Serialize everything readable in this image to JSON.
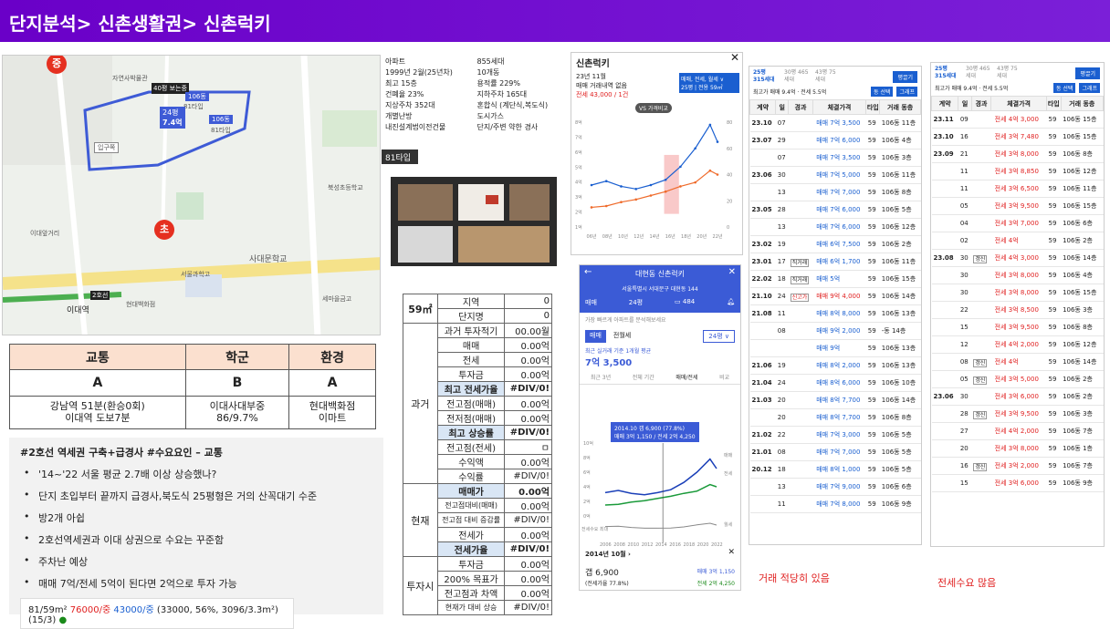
{
  "header": {
    "title": "단지분석> 신촌생활권> 신촌럭키"
  },
  "map": {
    "labels": [
      "자연사박물관",
      "중",
      "40평 보는중",
      "106동",
      "81타입",
      "24평",
      "7.4억",
      "81타입",
      "106동",
      "입구쪽",
      "사천로",
      "기아 서비스",
      "이대앞거리",
      "이대역",
      "아현웨딩타운",
      "사대문학교",
      "이대역",
      "서울과학고",
      "현대백화점",
      "세마을금고",
      "초",
      "2호선",
      "동교회",
      "북아현동주민센터",
      "북성초등학교"
    ],
    "pin_top": "중",
    "pin_bottom": "초"
  },
  "grade": {
    "headers": [
      "교통",
      "학군",
      "환경"
    ],
    "grades": [
      "A",
      "B",
      "A"
    ],
    "details": [
      [
        "강남역 51분(환승0회)",
        "이대역 도보7분"
      ],
      [
        "이대사대부중",
        "86/9.7%"
      ],
      [
        "현대백화점",
        "이마트"
      ]
    ]
  },
  "notes": {
    "title": "#2호선 역세권 구축+급경사   #수요요인 – 교통",
    "items": [
      "'14~'22 서울 평균 2.7배 이상 상승했나?",
      "단지 초입부터 끝까지 급경사,북도식 25평형은 거의 산꼭대기 수준",
      "방2개 아쉽",
      "2호선역세권과 이대 상권으로 수요는 꾸준함",
      "주차난 예상",
      "매매 7억/전세 5억이 된다면 2억으로 투자 가능"
    ],
    "summary": {
      "a": "81/59m²",
      "b": "76000/중",
      "c": "43000/중",
      "d": "(33000, 56%, 3096/3.3m²)(15/3)"
    }
  },
  "info": {
    "items": [
      "아파트",
      "855세대",
      "1999년 2월(25년차)",
      "10개동",
      "최고 15층",
      "용적률 229%",
      "건폐율 23%",
      "지하주차 165대",
      "지상주차 352대",
      "혼합식 (계단식,복도식)",
      "개별난방",
      "도시가스",
      "내진설계법이전건물",
      "단지/주변 약한 경사"
    ],
    "plan_label": "81타입"
  },
  "calc": {
    "size": "59㎡",
    "rows": [
      [
        "지역",
        "0"
      ],
      [
        "단지명",
        "0"
      ],
      [
        "과거 투자적기",
        "00.00월"
      ],
      [
        "매매",
        "0.00억"
      ],
      [
        "전세",
        "0.00억"
      ],
      [
        "투자금",
        "0.00억"
      ],
      [
        "최고 전세가율",
        "#DIV/0!"
      ],
      [
        "전고점(매매)",
        "0.00억"
      ],
      [
        "전저점(매매)",
        "0.00억"
      ],
      [
        "최고 상승률",
        "#DIV/0!"
      ],
      [
        "전고점(전세)",
        "ㅁ"
      ],
      [
        "수익액",
        "0.00억"
      ],
      [
        "수익률",
        "#DIV/0!"
      ],
      [
        "매매가",
        "0.00억"
      ],
      [
        "전고점대비(매매)",
        "0.00억"
      ],
      [
        "전고점 대비 증감률",
        "#DIV/0!"
      ],
      [
        "전세가",
        "0.00억"
      ],
      [
        "전세가율",
        "#DIV/0!"
      ],
      [
        "투자금",
        "0.00억"
      ],
      [
        "200% 목표가",
        "0.00억"
      ],
      [
        "전고점과 차액",
        "0.00억"
      ],
      [
        "현재가 대비 상승",
        "#DIV/0!"
      ]
    ],
    "sections": [
      "과거",
      "현재",
      "투자시"
    ]
  },
  "chart1": {
    "title": "신촌럭키",
    "sub": "23년 11월",
    "sub2": "매매 거래내역 없음",
    "price": "전세 43,000 / 1건",
    "filter": "매매, 전세, 월세 ∨",
    "filter2": "25평 | 전용 59㎡",
    "vs": "VS 가격비교",
    "years": [
      "06년",
      "08년",
      "10년",
      "12년",
      "14년",
      "16년",
      "18년",
      "20년",
      "22년"
    ],
    "yticks": [
      "8억",
      "7억",
      "6억",
      "5억",
      "4억",
      "3억",
      "2억",
      "1억"
    ],
    "yticks_r": [
      "80",
      "60",
      "40",
      "20",
      "0"
    ]
  },
  "chart1_data": {
    "type": "line",
    "x": [
      2006,
      2008,
      2010,
      2012,
      2014,
      2016,
      2018,
      2020,
      2022,
      2023
    ],
    "series": [
      {
        "name": "매매",
        "values": [
          3.2,
          3.5,
          3.1,
          2.9,
          3.2,
          3.6,
          4.6,
          6.0,
          7.8,
          6.5
        ]
      },
      {
        "name": "전세",
        "values": [
          1.5,
          1.6,
          1.9,
          2.1,
          2.4,
          2.7,
          3.1,
          3.4,
          4.3,
          4.0
        ]
      }
    ]
  },
  "app": {
    "title": "대현동 신촌럭키",
    "addr": "서울특별시 서대문구 대현동 144",
    "tab1": "매매",
    "size": "24평",
    "comments": "484",
    "banner": "가장 빠르게 아파트를 분석해보세요",
    "t1": "매매",
    "t2": "전월세",
    "sizebox": "24평 ∨",
    "recent": "최근 실거래 기준 1개월 평균",
    "price": "7억 3,500",
    "p1": "최근 3년",
    "p2": "전체 기간",
    "p3": "매매/전세",
    "p4": "비교",
    "tip1": "2014.10  갭 6,900 (77.8%)",
    "tip2": "매매 3억 1,150 / 전세 2억 4,250",
    "yl": [
      "10억",
      "8억",
      "6억",
      "4억",
      "2억",
      "0억"
    ],
    "sub": "전세수요 최대",
    "xl": [
      "2006",
      "2008",
      "2010",
      "2012",
      "2014",
      "2016",
      "2018",
      "2020",
      "2022"
    ],
    "rl": [
      "매매",
      "전세",
      "월세"
    ],
    "date": "2014년 10월",
    "gap": "갭 6,900",
    "gapr": "(전세가율 77.8%)",
    "sale": "매매  3억 1,150",
    "jeon": "전세  2억 4,250"
  },
  "table1": {
    "tabs": [
      "25평 315세대",
      "30평 465세대",
      "43평 75세대"
    ],
    "btn": "평끌기",
    "filter": "최고가 매매 9.4억 · 전세 5.5억",
    "f1": "동 선택",
    "f2": "그래프",
    "headers": [
      "계약",
      "일",
      "경과",
      "체결가격",
      "타입",
      "거래 동층"
    ],
    "rows": [
      [
        "23.10",
        "07",
        "",
        "매매 7억 3,500",
        "59",
        "106동 11층"
      ],
      [
        "23.07",
        "29",
        "",
        "매매 7억 6,000",
        "59",
        "106동 4층"
      ],
      [
        "",
        "07",
        "",
        "매매 7억 3,500",
        "59",
        "106동 3층"
      ],
      [
        "23.06",
        "30",
        "",
        "매매 7억 5,000",
        "59",
        "106동 11층"
      ],
      [
        "",
        "13",
        "",
        "매매 7억 7,000",
        "59",
        "106동 8층"
      ],
      [
        "23.05",
        "28",
        "",
        "매매 7억 6,000",
        "59",
        "106동 5층"
      ],
      [
        "",
        "13",
        "",
        "매매 7억 6,000",
        "59",
        "106동 12층"
      ],
      [
        "23.02",
        "19",
        "",
        "매매 6억 7,500",
        "59",
        "106동 2층"
      ],
      [
        "23.01",
        "17",
        "직거래",
        "매매 6억 1,700",
        "59",
        "106동 11층"
      ],
      [
        "22.02",
        "18",
        "직거래",
        "매매 5억",
        "59",
        "106동 15층"
      ],
      [
        "21.10",
        "24",
        "신고가",
        "매매 9억 4,000",
        "59",
        "106동 14층"
      ],
      [
        "21.08",
        "11",
        "",
        "매매 8억 8,000",
        "59",
        "106동 13층"
      ],
      [
        "",
        "08",
        "",
        "매매 9억 2,000",
        "59",
        "-동 14층"
      ],
      [
        "",
        "",
        "",
        "매매 9억",
        "59",
        "106동 13층"
      ],
      [
        "21.06",
        "19",
        "",
        "매매 8억 2,000",
        "59",
        "106동 13층"
      ],
      [
        "21.04",
        "24",
        "",
        "매매 8억 6,000",
        "59",
        "106동 10층"
      ],
      [
        "21.03",
        "20",
        "",
        "매매 8억 7,700",
        "59",
        "106동 14층"
      ],
      [
        "",
        "20",
        "",
        "매매 8억 7,700",
        "59",
        "106동 8층"
      ],
      [
        "21.02",
        "22",
        "",
        "매매 7억 3,000",
        "59",
        "106동 5층"
      ],
      [
        "21.01",
        "08",
        "",
        "매매 7억 7,000",
        "59",
        "106동 5층"
      ],
      [
        "20.12",
        "18",
        "",
        "매매 8억 1,000",
        "59",
        "106동 5층"
      ],
      [
        "",
        "13",
        "",
        "매매 7억 9,000",
        "59",
        "106동 6층"
      ],
      [
        "",
        "11",
        "",
        "매매 7억 8,000",
        "59",
        "106동 9층"
      ]
    ]
  },
  "table2": {
    "tabs": [
      "25평 315세대",
      "30평 465세대",
      "43평 75세대"
    ],
    "btn": "평끌기",
    "filter": "최고가 매매 9.4억 · 전세 5.5억",
    "f1": "동 선택",
    "f2": "그래프",
    "headers": [
      "계약",
      "일",
      "경과",
      "체결가격",
      "타입",
      "거래 동층"
    ],
    "rows": [
      [
        "23.11",
        "09",
        "",
        "전세 4억 3,000",
        "59",
        "106동 15층"
      ],
      [
        "23.10",
        "16",
        "",
        "전세 3억 7,480",
        "59",
        "106동 15층"
      ],
      [
        "23.09",
        "21",
        "",
        "전세 3억 8,000",
        "59",
        "106동 8층"
      ],
      [
        "",
        "11",
        "",
        "전세 3억 8,850",
        "59",
        "106동 12층"
      ],
      [
        "",
        "11",
        "",
        "전세 3억 6,500",
        "59",
        "106동 11층"
      ],
      [
        "",
        "05",
        "",
        "전세 3억 9,500",
        "59",
        "106동 15층"
      ],
      [
        "",
        "04",
        "",
        "전세 3억 7,000",
        "59",
        "106동 6층"
      ],
      [
        "",
        "02",
        "",
        "전세 4억",
        "59",
        "106동 2층"
      ],
      [
        "23.08",
        "30",
        "갱신",
        "전세 4억 3,000",
        "59",
        "106동 14층"
      ],
      [
        "",
        "30",
        "",
        "전세 3억 8,000",
        "59",
        "106동 4층"
      ],
      [
        "",
        "30",
        "",
        "전세 3억 8,000",
        "59",
        "106동 15층"
      ],
      [
        "",
        "22",
        "",
        "전세 3억 8,500",
        "59",
        "106동 3층"
      ],
      [
        "",
        "15",
        "",
        "전세 3억 9,500",
        "59",
        "106동 8층"
      ],
      [
        "",
        "12",
        "",
        "전세 4억 2,000",
        "59",
        "106동 12층"
      ],
      [
        "",
        "08",
        "갱신",
        "전세 4억",
        "59",
        "106동 14층"
      ],
      [
        "",
        "05",
        "갱신",
        "전세 3억 5,000",
        "59",
        "106동 2층"
      ],
      [
        "23.06",
        "30",
        "",
        "전세 3억 6,000",
        "59",
        "106동 2층"
      ],
      [
        "",
        "28",
        "갱신",
        "전세 3억 9,500",
        "59",
        "106동 3층"
      ],
      [
        "",
        "27",
        "",
        "전세 4억 2,000",
        "59",
        "106동 7층"
      ],
      [
        "",
        "20",
        "",
        "전세 3억 8,000",
        "59",
        "106동 1층"
      ],
      [
        "",
        "16",
        "갱신",
        "전세 3억 2,000",
        "59",
        "106동 7층"
      ],
      [
        "",
        "15",
        "",
        "전세 3억 6,000",
        "59",
        "106동 9층"
      ]
    ]
  },
  "memos": [
    "거래 적당히 있음",
    "전세수요 많음"
  ]
}
